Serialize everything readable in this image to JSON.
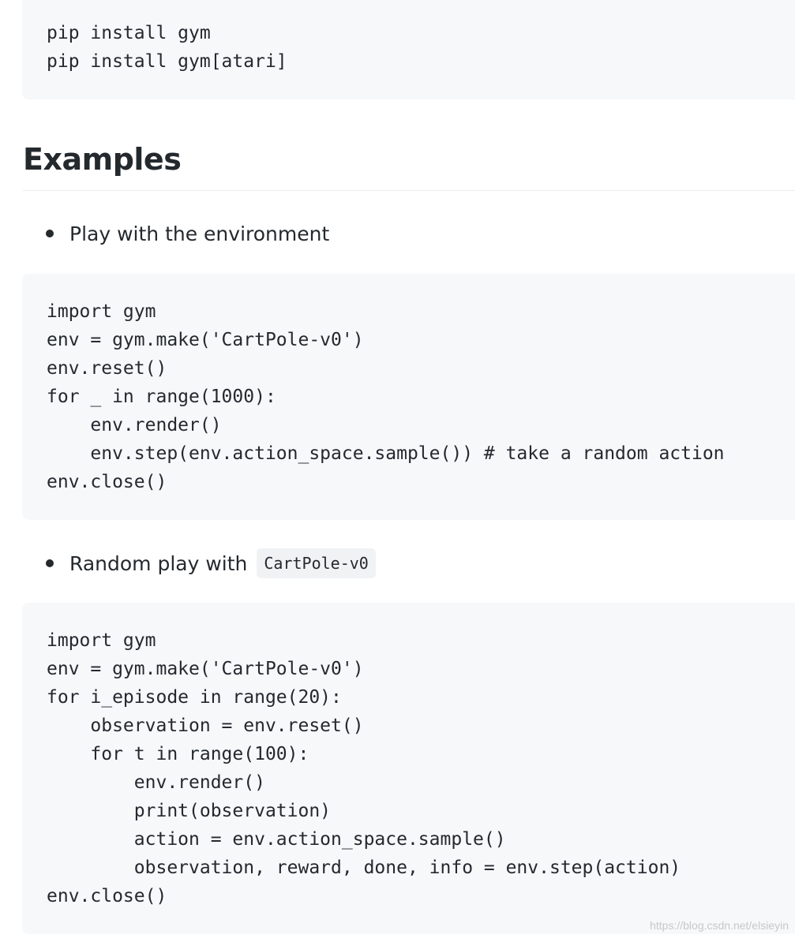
{
  "install_block": {
    "lines": [
      "pip install gym",
      "pip install gym[atari]"
    ]
  },
  "heading": "Examples",
  "section1": {
    "bullet_text": "Play with the environment",
    "lines": [
      "import gym",
      "env = gym.make('CartPole-v0')",
      "env.reset()",
      "for _ in range(1000):",
      "    env.render()",
      "    env.step(env.action_space.sample()) # take a random action",
      "env.close()"
    ]
  },
  "section2": {
    "bullet_text": "Random play with",
    "inline_code": "CartPole-v0",
    "lines": [
      "import gym",
      "env = gym.make('CartPole-v0')",
      "for i_episode in range(20):",
      "    observation = env.reset()",
      "    for t in range(100):",
      "        env.render()",
      "        print(observation)",
      "        action = env.action_space.sample()",
      "        observation, reward, done, info = env.step(action)",
      "env.close()"
    ]
  },
  "watermark": "https://blog.csdn.net/elsieyin"
}
